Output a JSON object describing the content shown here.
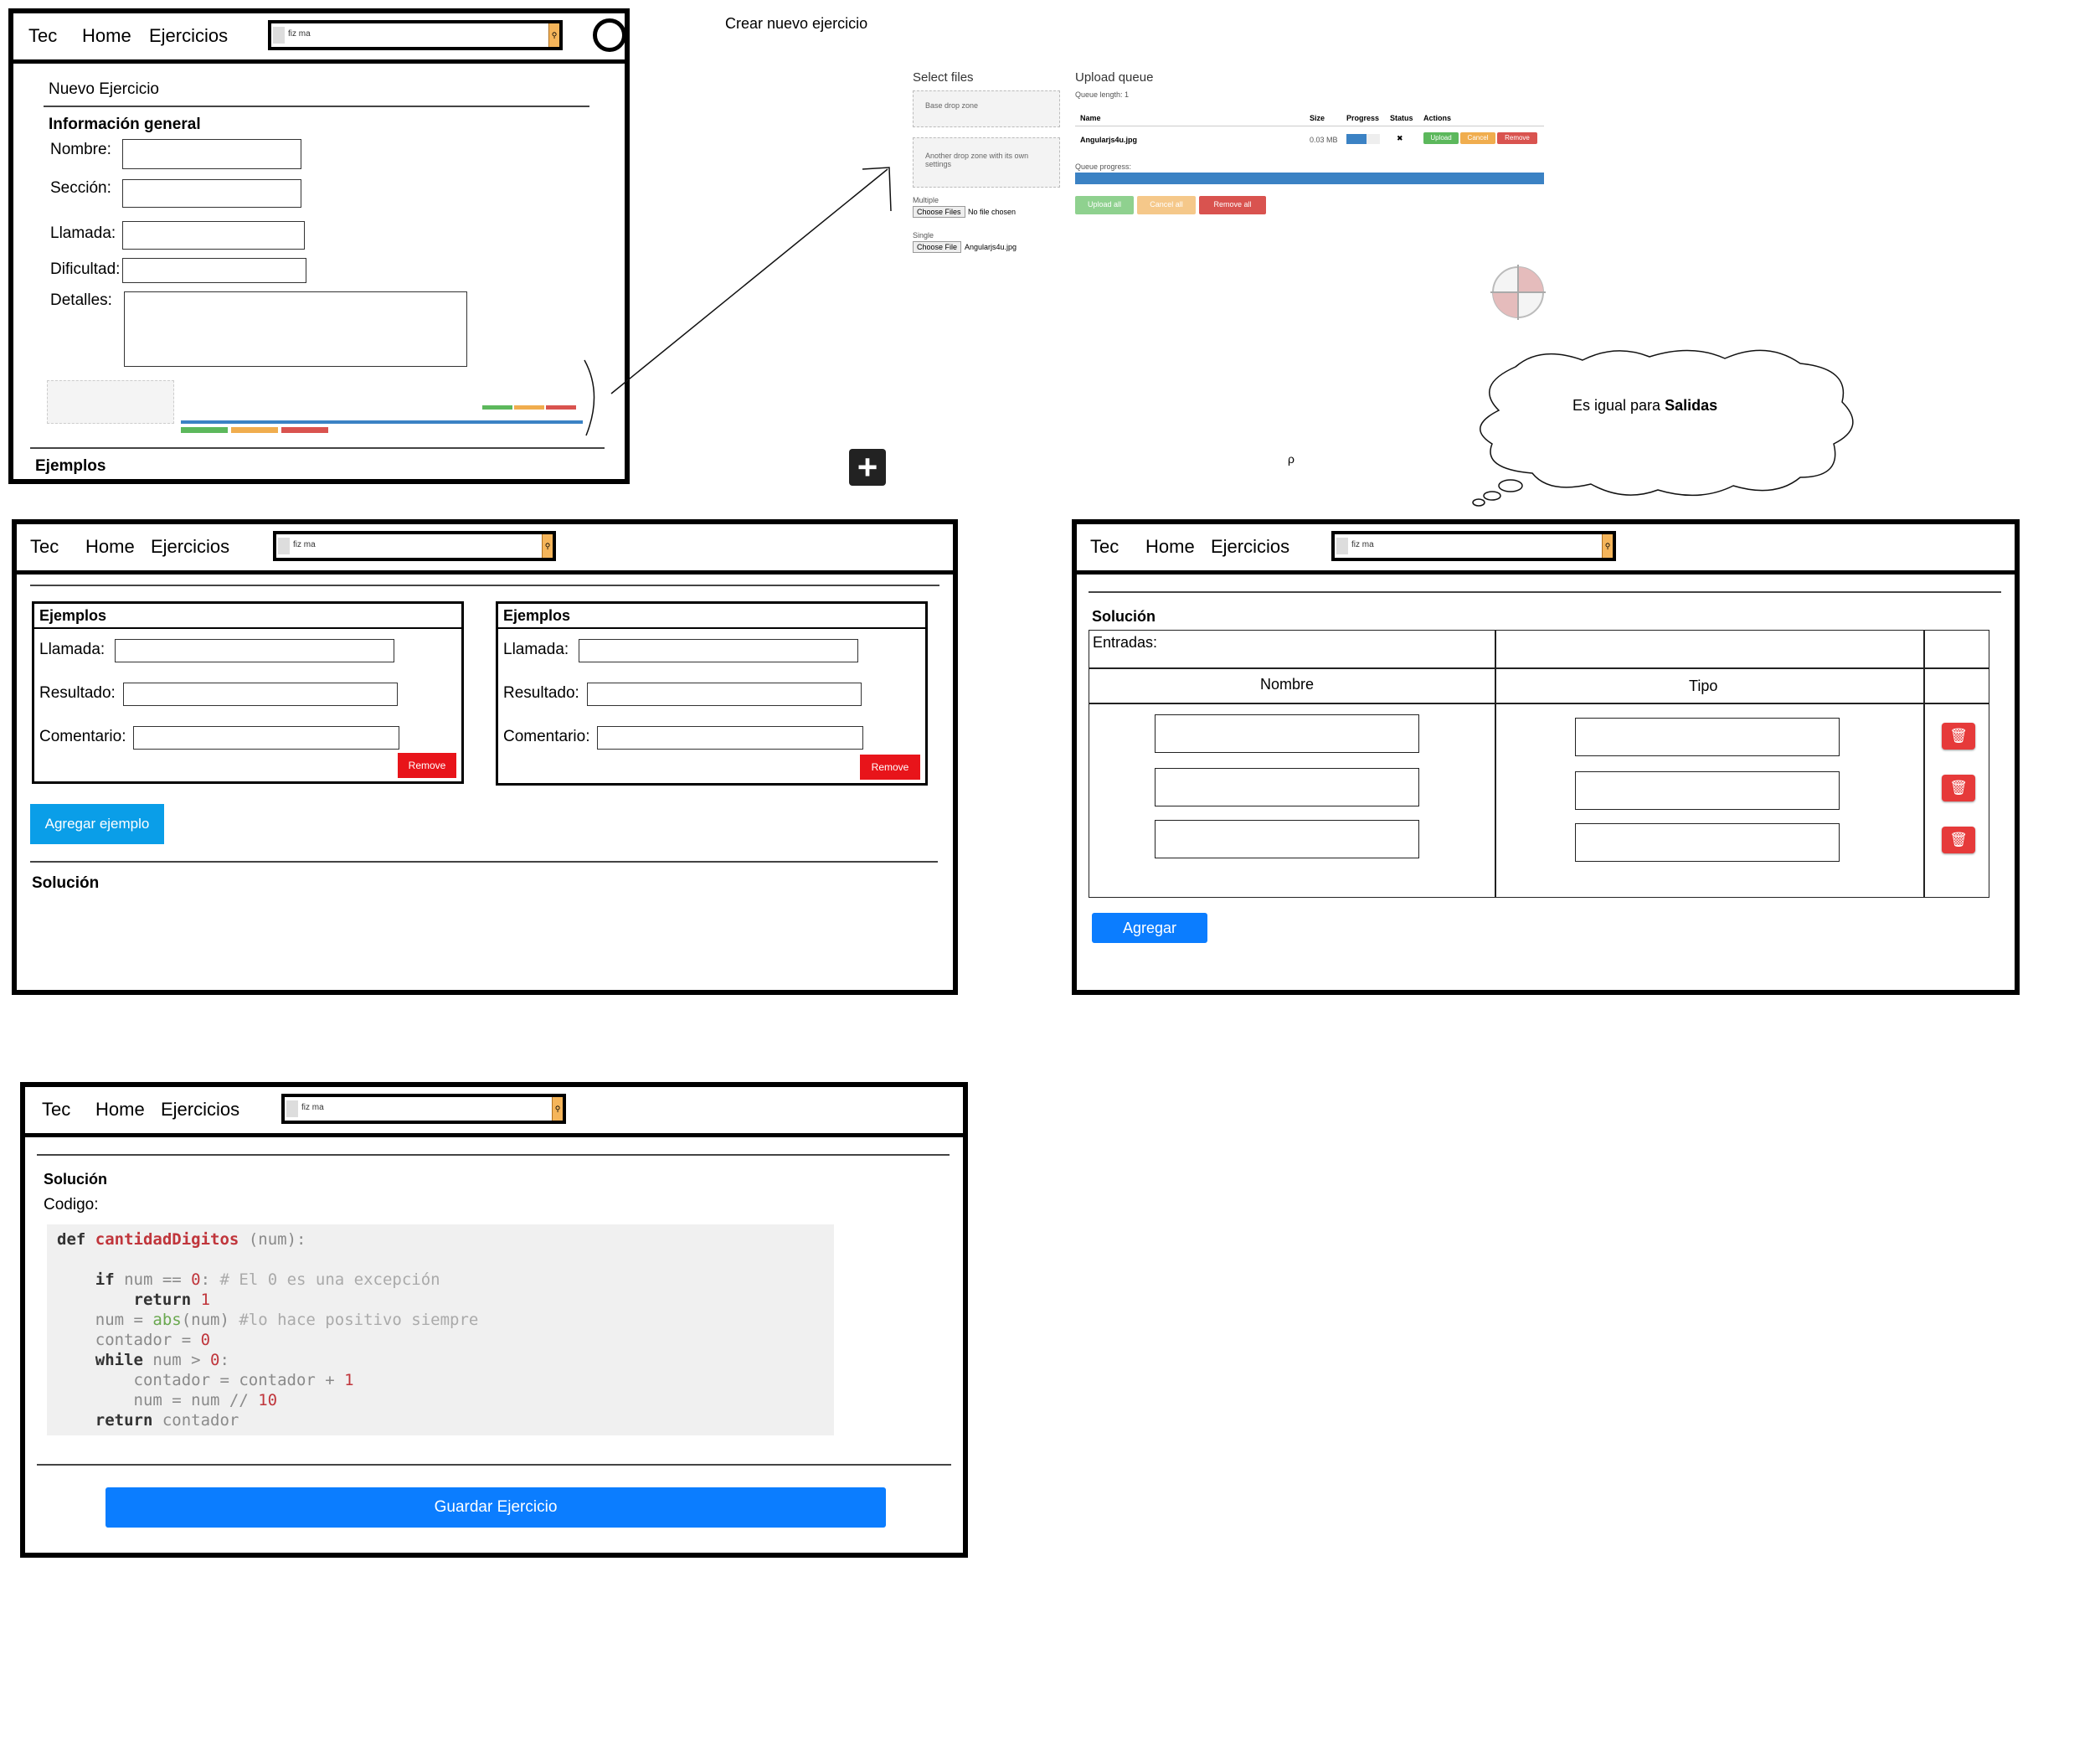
{
  "top_label": "Crear nuevo ejercicio",
  "nav": {
    "brand": "Tec",
    "home": "Home",
    "ejercicios": "Ejercicios",
    "search_value": "fiz ma"
  },
  "form1": {
    "title": "Nuevo Ejercicio",
    "section": "Información general",
    "nombre_label": "Nombre:",
    "seccion_label": "Sección:",
    "llamada_label": "Llamada:",
    "dificultad_label": "Dificultad:",
    "detalles_label": "Detalles:",
    "ejemplos_heading": "Ejemplos"
  },
  "upload": {
    "select_files": "Select files",
    "base_drop_zone": "Base drop zone",
    "another_drop_zone": "Another drop zone with its own settings",
    "multiple": "Multiple",
    "choose_files": "Choose Files",
    "no_file": "No file chosen",
    "single": "Single",
    "choose_file": "Choose File",
    "single_file": "Angularjs4u.jpg",
    "queue_title": "Upload queue",
    "queue_length": "Queue length: 1",
    "col_name": "Name",
    "col_size": "Size",
    "col_progress": "Progress",
    "col_status": "Status",
    "col_actions": "Actions",
    "row_name": "Angularjs4u.jpg",
    "row_size": "0.03 MB",
    "row_status": "✖",
    "btn_upload": "Upload",
    "btn_cancel": "Cancel",
    "btn_remove": "Remove",
    "queue_progress": "Queue progress:",
    "btn_upload_all": "Upload all",
    "btn_cancel_all": "Cancel all",
    "btn_remove_all": "Remove all",
    "row_progress": 0.6,
    "queue_progress_value": 1.0
  },
  "thought": {
    "text_prefix": "Es igual para ",
    "text_bold": "Salidas"
  },
  "stray_mark": "ρ",
  "ejemplos_panel": {
    "card_title": "Ejemplos",
    "llamada_label": "Llamada:",
    "resultado_label": "Resultado:",
    "comentario_label": "Comentario:",
    "remove_label": "Remove",
    "add_button": "Agregar ejemplo",
    "solucion_heading": "Solución"
  },
  "solucion_panel": {
    "heading": "Solución",
    "entradas_label": "Entradas:",
    "col_nombre": "Nombre",
    "col_tipo": "Tipo",
    "trash_icon": "🗑",
    "add_button": "Agregar"
  },
  "codigo_panel": {
    "heading": "Solución",
    "codigo_label": "Codigo:",
    "save_button": "Guardar Ejercicio",
    "code_lines": [
      "def cantidadDigitos (num):",
      "",
      "    if num == 0: # El 0 es una excepción",
      "        return 1",
      "    num = abs(num) #lo hace positivo siempre",
      "    contador = 0",
      "    while num > 0:",
      "        contador = contador + 1",
      "        num = num // 10",
      "    return contador"
    ]
  }
}
